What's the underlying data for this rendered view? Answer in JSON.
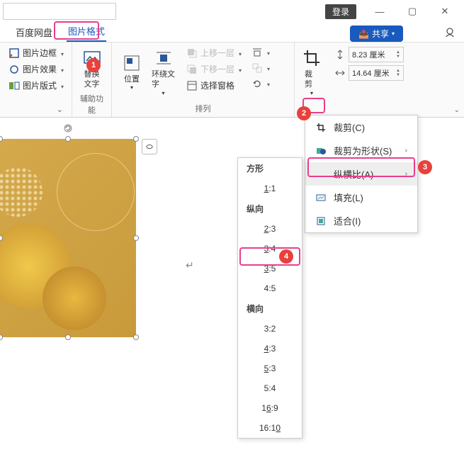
{
  "titlebar": {
    "login": "登录"
  },
  "tabs": {
    "baidu": "百度网盘",
    "format": "图片格式",
    "share": "共享"
  },
  "ribbon": {
    "border": "图片边框",
    "effect": "图片效果",
    "layout": "图片版式",
    "alttext": "替换\n文字",
    "group_access": "辅助功能",
    "position": "位置",
    "wrap": "环绕文\n字",
    "forward": "上移一层",
    "backward": "下移一层",
    "pane": "选择窗格",
    "group_arrange": "排列",
    "crop": "裁剪",
    "height": "8.23 厘米",
    "width": "14.64 厘米"
  },
  "crop_menu": {
    "crop": "裁剪(C)",
    "shape": "裁剪为形状(S)",
    "aspect": "纵横比(A)",
    "fill": "填充(L)",
    "fit": "适合(I)"
  },
  "aspect_menu": {
    "square": "方形",
    "r11": "1:1",
    "portrait": "纵向",
    "r23": "2:3",
    "r34": "3:4",
    "r35": "3:5",
    "r45": "4:5",
    "landscape": "横向",
    "r32": "3:2",
    "r43": "4:3",
    "r53": "5:3",
    "r54": "5:4",
    "r169": "16:9",
    "r1610": "16:10"
  },
  "callouts": {
    "c1": "1",
    "c2": "2",
    "c3": "3",
    "c4": "4"
  }
}
